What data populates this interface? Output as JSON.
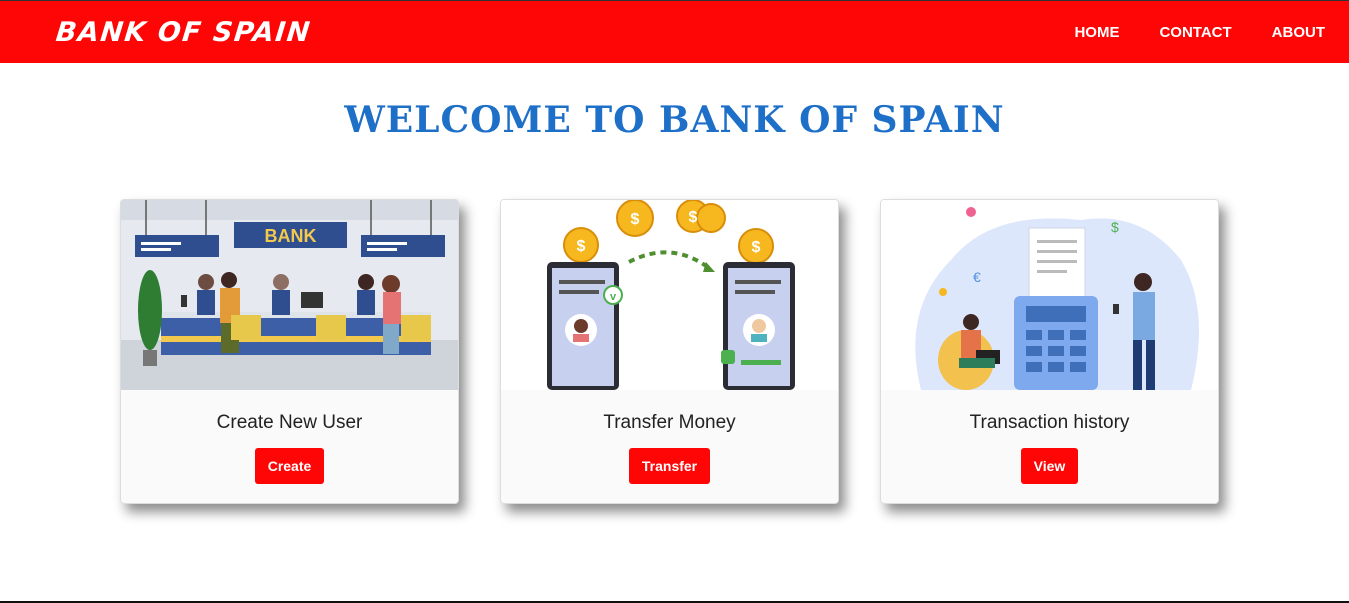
{
  "navbar": {
    "brand": "BANK OF SPAIN",
    "links": [
      {
        "label": "HOME"
      },
      {
        "label": "CONTACT"
      },
      {
        "label": "ABOUT"
      }
    ]
  },
  "welcome": "WELCOME TO BANK OF SPAIN",
  "bank_sign": "BANK",
  "cards": [
    {
      "title": "Create New User",
      "button": "Create"
    },
    {
      "title": "Transfer Money",
      "button": "Transfer"
    },
    {
      "title": "Transaction history",
      "button": "View"
    }
  ],
  "colors": {
    "accent": "#ff0606",
    "heading": "#1e6fc8"
  }
}
